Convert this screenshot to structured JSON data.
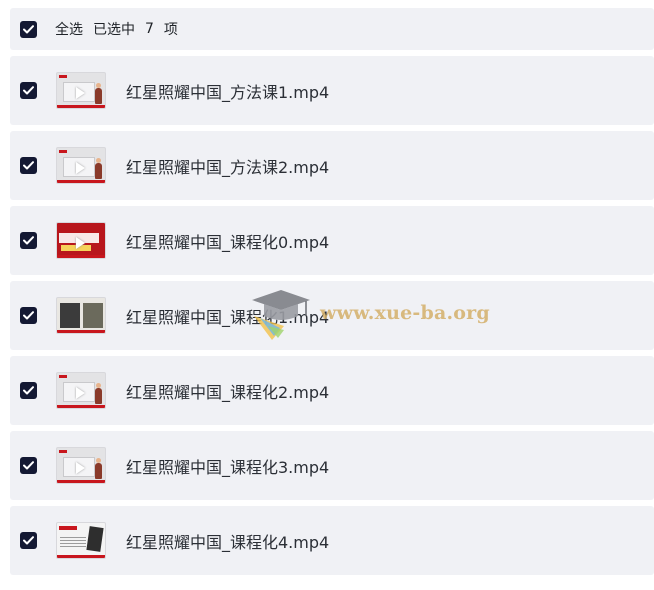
{
  "header": {
    "select_all_label": "全选",
    "selected_prefix": "已选中",
    "selected_count": "7",
    "selected_suffix": "项",
    "all_checked": true
  },
  "files": [
    {
      "name": "红星照耀中国_方法课1.mp4",
      "checked": true,
      "thumb": "play-figure"
    },
    {
      "name": "红星照耀中国_方法课2.mp4",
      "checked": true,
      "thumb": "play-figure"
    },
    {
      "name": "红星照耀中国_课程化0.mp4",
      "checked": true,
      "thumb": "red-banner"
    },
    {
      "name": "红星照耀中国_课程化1.mp4",
      "checked": true,
      "thumb": "portraits"
    },
    {
      "name": "红星照耀中国_课程化2.mp4",
      "checked": true,
      "thumb": "play-figure"
    },
    {
      "name": "红星照耀中国_课程化3.mp4",
      "checked": true,
      "thumb": "play-figure"
    },
    {
      "name": "红星照耀中国_课程化4.mp4",
      "checked": true,
      "thumb": "dark-card"
    }
  ],
  "watermark": {
    "text": "www.xue-ba.org"
  },
  "colors": {
    "checkbox_fill": "#141933",
    "row_background": "#f0f1f5",
    "accent_red": "#c8161d",
    "watermark": "#d4b06a"
  }
}
